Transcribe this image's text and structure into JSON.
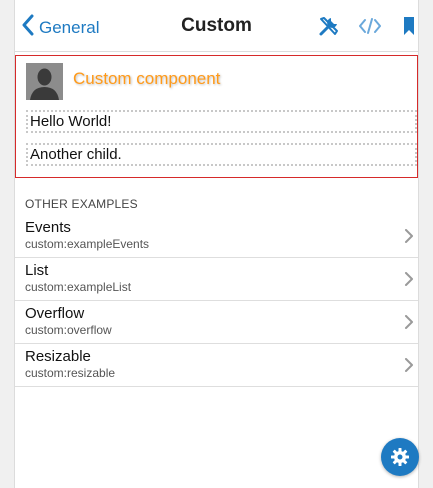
{
  "header": {
    "back_label": "General",
    "title": "Custom",
    "icons": [
      "tools-icon",
      "code-icon",
      "bookmark-icon"
    ]
  },
  "custom_component": {
    "title": "Custom component",
    "children": [
      "Hello World!",
      "Another child."
    ]
  },
  "other_examples": {
    "header": "OTHER EXAMPLES",
    "items": [
      {
        "title": "Events",
        "subtitle": "custom:exampleEvents"
      },
      {
        "title": "List",
        "subtitle": "custom:exampleList"
      },
      {
        "title": "Overflow",
        "subtitle": "custom:overflow"
      },
      {
        "title": "Resizable",
        "subtitle": "custom:resizable"
      }
    ]
  },
  "fab": {
    "icon": "gear-icon"
  },
  "colors": {
    "accent": "#1e7ac2",
    "custom_title": "#ff9a1a",
    "custom_border": "#d62a2a"
  }
}
